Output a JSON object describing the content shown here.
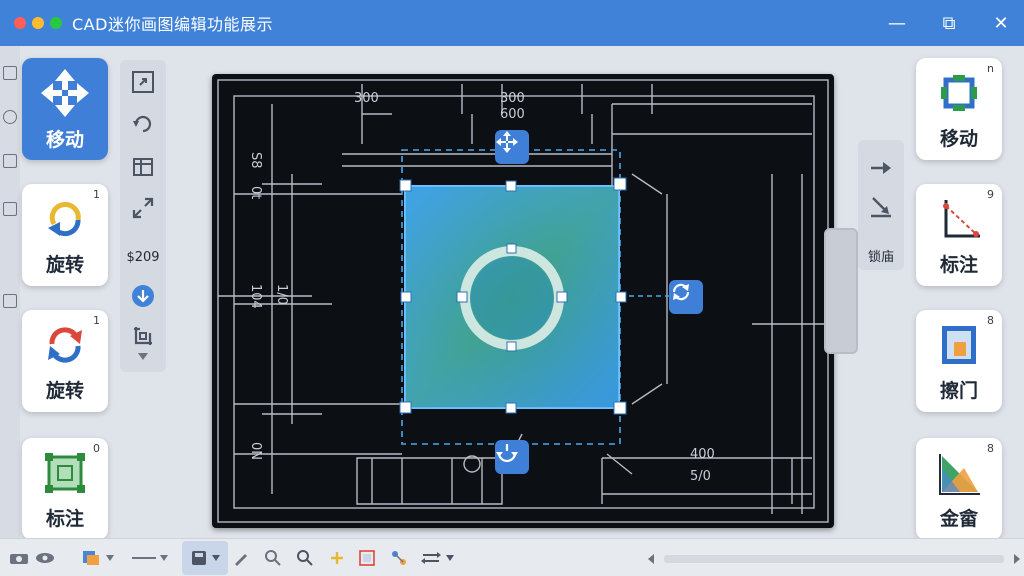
{
  "window": {
    "title": "CAD迷你画图编辑功能展示",
    "traffic_colors": [
      "#ff5f57",
      "#febc2e",
      "#28c840"
    ],
    "minimize_glyph": "—",
    "maximize_glyph": "⧉",
    "close_glyph": "✕"
  },
  "left_tools": [
    {
      "label": "移动",
      "badge": "",
      "icon": "move-arrows-icon",
      "active": true
    },
    {
      "label": "旋转",
      "badge": "1",
      "icon": "rotate-ccw-icon",
      "active": false
    },
    {
      "label": "旋转",
      "badge": "1",
      "icon": "rotate-cw-icon",
      "active": false
    },
    {
      "label": "标注",
      "badge": "0",
      "icon": "annotate-frame-icon",
      "active": false
    }
  ],
  "right_tools": [
    {
      "label": "移动",
      "badge": "n",
      "icon": "move-square-icon"
    },
    {
      "label": "标注",
      "badge": "9",
      "icon": "dimension-triangle-icon"
    },
    {
      "label": "擦门",
      "badge": "8",
      "icon": "door-icon"
    },
    {
      "label": "金畲",
      "badge": "8",
      "icon": "chart-triangle-icon"
    }
  ],
  "small_column": {
    "value_label": "$209"
  },
  "right_small_column": {
    "label": "锁庙"
  },
  "drawing": {
    "dim_top_left": "300",
    "dim_top_mid": "300",
    "dim_top_mid2": "600",
    "dim_left_a": "S8",
    "dim_left_b": "0t",
    "dim_left_mid": "104",
    "dim_left_mid2": "1/0",
    "dim_left_c": "0N",
    "dim_bottom_a": "400",
    "dim_bottom_b": "5/0"
  },
  "colors": {
    "accent": "#3f7fd8",
    "selection": "#4aa8e8",
    "canvas_bg": "#0c0f14"
  }
}
